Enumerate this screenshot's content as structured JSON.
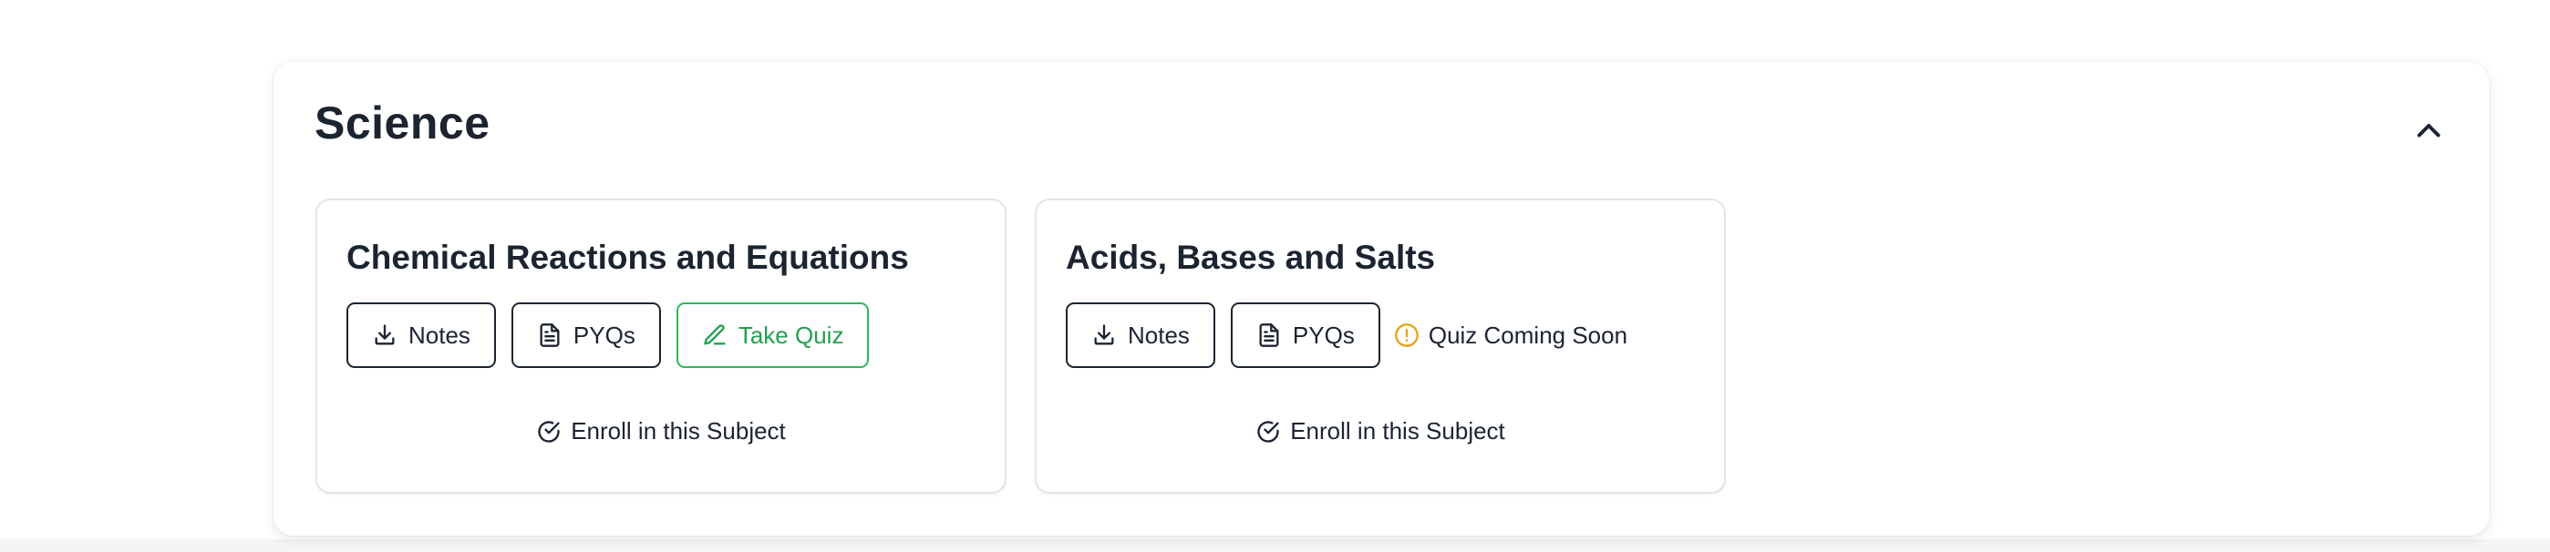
{
  "section": {
    "title": "Science"
  },
  "subjects": [
    {
      "title": "Chemical Reactions and Equations",
      "notes_label": "Notes",
      "pyqs_label": "PYQs",
      "quiz_label": "Take Quiz",
      "enroll_label": "Enroll in this Subject"
    },
    {
      "title": "Acids, Bases and Salts",
      "notes_label": "Notes",
      "pyqs_label": "PYQs",
      "quiz_status": "Quiz Coming Soon",
      "enroll_label": "Enroll in this Subject"
    }
  ],
  "colors": {
    "text": "#1c2431",
    "quiz_green": "#22a04f",
    "warning_amber": "#e8a317"
  },
  "icons": {
    "collapse": "chevron-up-icon",
    "notes": "download-icon",
    "pyqs": "document-icon",
    "quiz": "pencil-icon",
    "coming_soon": "alert-circle-icon",
    "enroll": "check-circle-icon"
  }
}
